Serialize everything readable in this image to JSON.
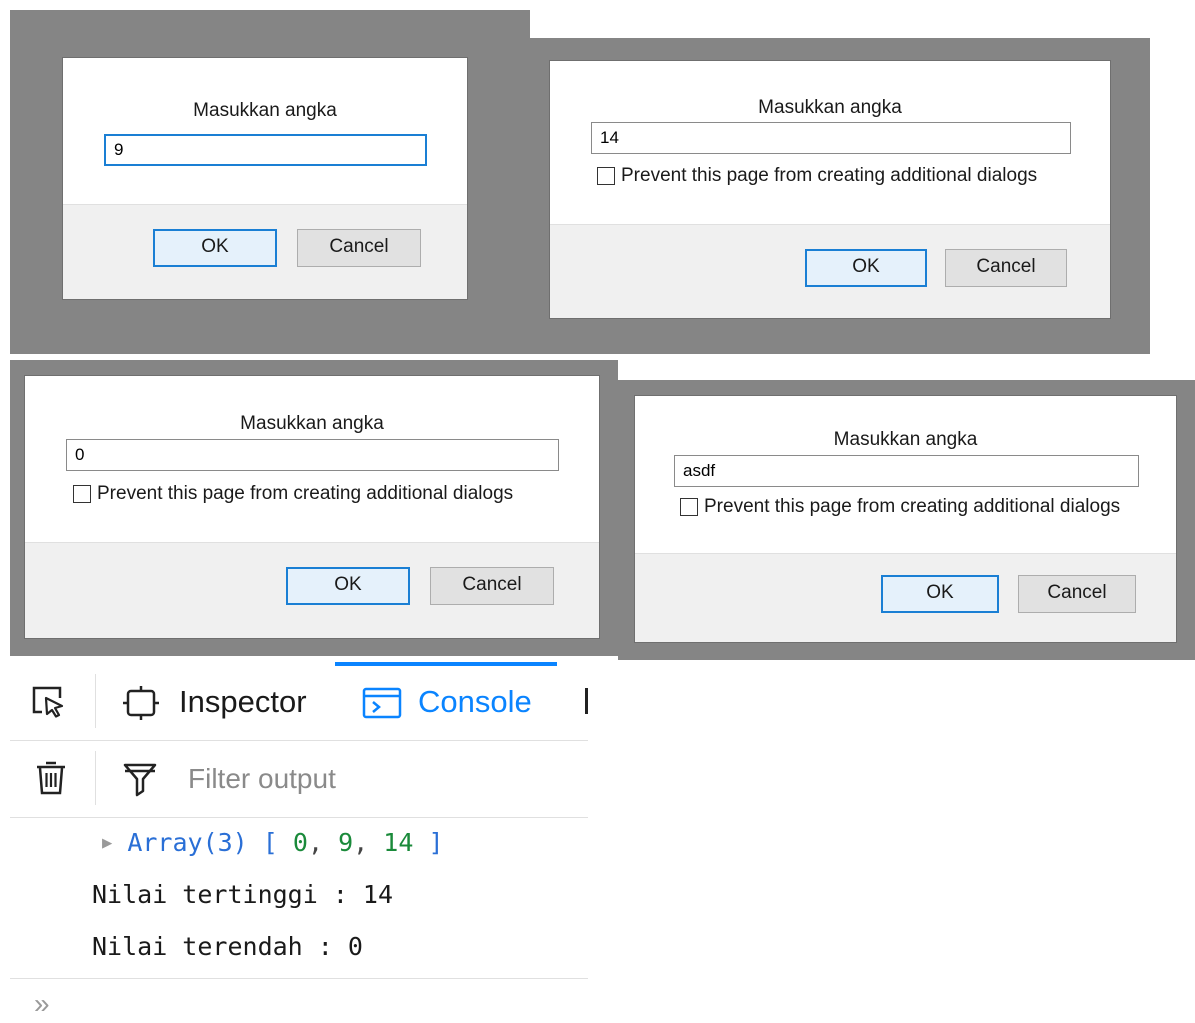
{
  "dialogs": [
    {
      "title": "Masukkan angka",
      "value": "9",
      "checkbox_label": "",
      "ok_label": "OK",
      "cancel_label": "Cancel"
    },
    {
      "title": "Masukkan angka",
      "value": "14",
      "checkbox_label": "Prevent this page from creating additional dialogs",
      "ok_label": "OK",
      "cancel_label": "Cancel"
    },
    {
      "title": "Masukkan angka",
      "value": "0",
      "checkbox_label": "Prevent this page from creating additional dialogs",
      "ok_label": "OK",
      "cancel_label": "Cancel"
    },
    {
      "title": "Masukkan angka",
      "value": "asdf",
      "checkbox_label": "Prevent this page from creating additional dialogs",
      "ok_label": "OK",
      "cancel_label": "Cancel"
    }
  ],
  "devtools": {
    "tabs": [
      {
        "label": "Inspector",
        "icon": "inspector-frame-icon",
        "active": false
      },
      {
        "label": "Console",
        "icon": "console-icon",
        "active": true
      }
    ],
    "filter_placeholder": "Filter output",
    "console": {
      "array_label": "Array(3)",
      "array_open": "[",
      "array_values": [
        "0",
        "9",
        "14"
      ],
      "array_close": "]",
      "lines": [
        "Nilai tertinggi : 14",
        "Nilai terendah : 0"
      ],
      "prompt": "»"
    },
    "colors": {
      "accent": "#0a84ff",
      "array_blue": "#2a6fd6",
      "number_green": "#1a8a3a"
    }
  }
}
